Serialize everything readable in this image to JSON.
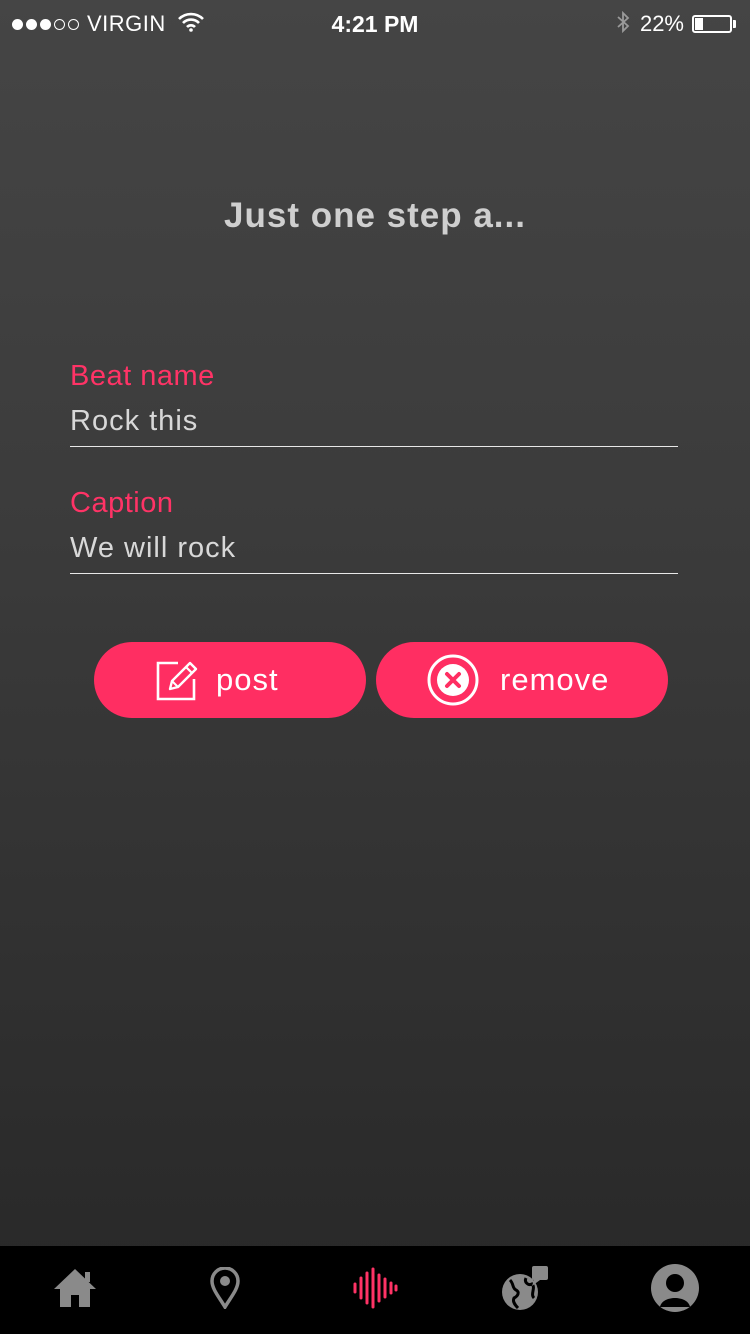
{
  "status_bar": {
    "carrier": "VIRGIN",
    "time": "4:21 PM",
    "battery_percent": "22%",
    "battery_level": 0.22,
    "signal_bars_filled": 3,
    "signal_bars_total": 5
  },
  "page": {
    "title": "Just one step a..."
  },
  "form": {
    "beat_name": {
      "label": "Beat name",
      "value": "Rock this"
    },
    "caption": {
      "label": "Caption",
      "value": "We will rock"
    }
  },
  "actions": {
    "post": {
      "label": "post",
      "icon": "edit-icon"
    },
    "remove": {
      "label": "remove",
      "icon": "close-circle-icon"
    }
  },
  "tab_bar": {
    "items": [
      {
        "name": "home",
        "icon": "home-icon",
        "active": false
      },
      {
        "name": "location",
        "icon": "location-pin-icon",
        "active": false
      },
      {
        "name": "beats",
        "icon": "soundwave-icon",
        "active": true
      },
      {
        "name": "world",
        "icon": "globe-chat-icon",
        "active": false
      },
      {
        "name": "profile",
        "icon": "profile-icon",
        "active": false
      }
    ]
  },
  "colors": {
    "accent": "#ff2e62",
    "tab_inactive": "#8a8a8a",
    "tab_active": "#ff3366"
  }
}
